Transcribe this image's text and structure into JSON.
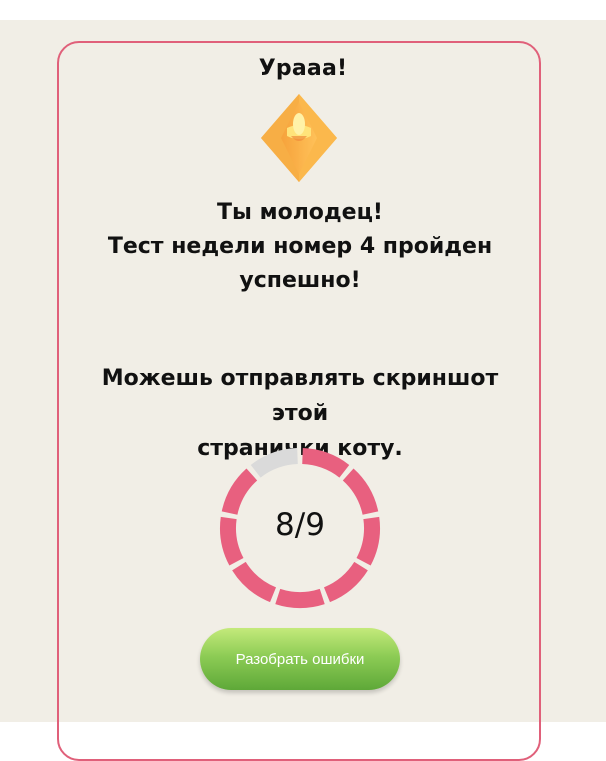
{
  "card": {
    "title": "Урааа!",
    "message_line1": "Ты молодец!",
    "message_line2": "Тест недели номер 4 пройден",
    "message_line3": "успешно!",
    "instruction_line1": "Можешь отправлять скриншот этой",
    "instruction_line2": "странички коту.",
    "badge_icon": "crystal-icon"
  },
  "score": {
    "correct": 8,
    "total": 9,
    "label": "8/9"
  },
  "buttons": {
    "review_label": "Разобрать ошибки"
  },
  "colors": {
    "accent": "#e8607f",
    "card_border": "#e0607a",
    "ring_empty": "#dadada",
    "background": "#f1eee6",
    "button_green": "#6fb845"
  }
}
